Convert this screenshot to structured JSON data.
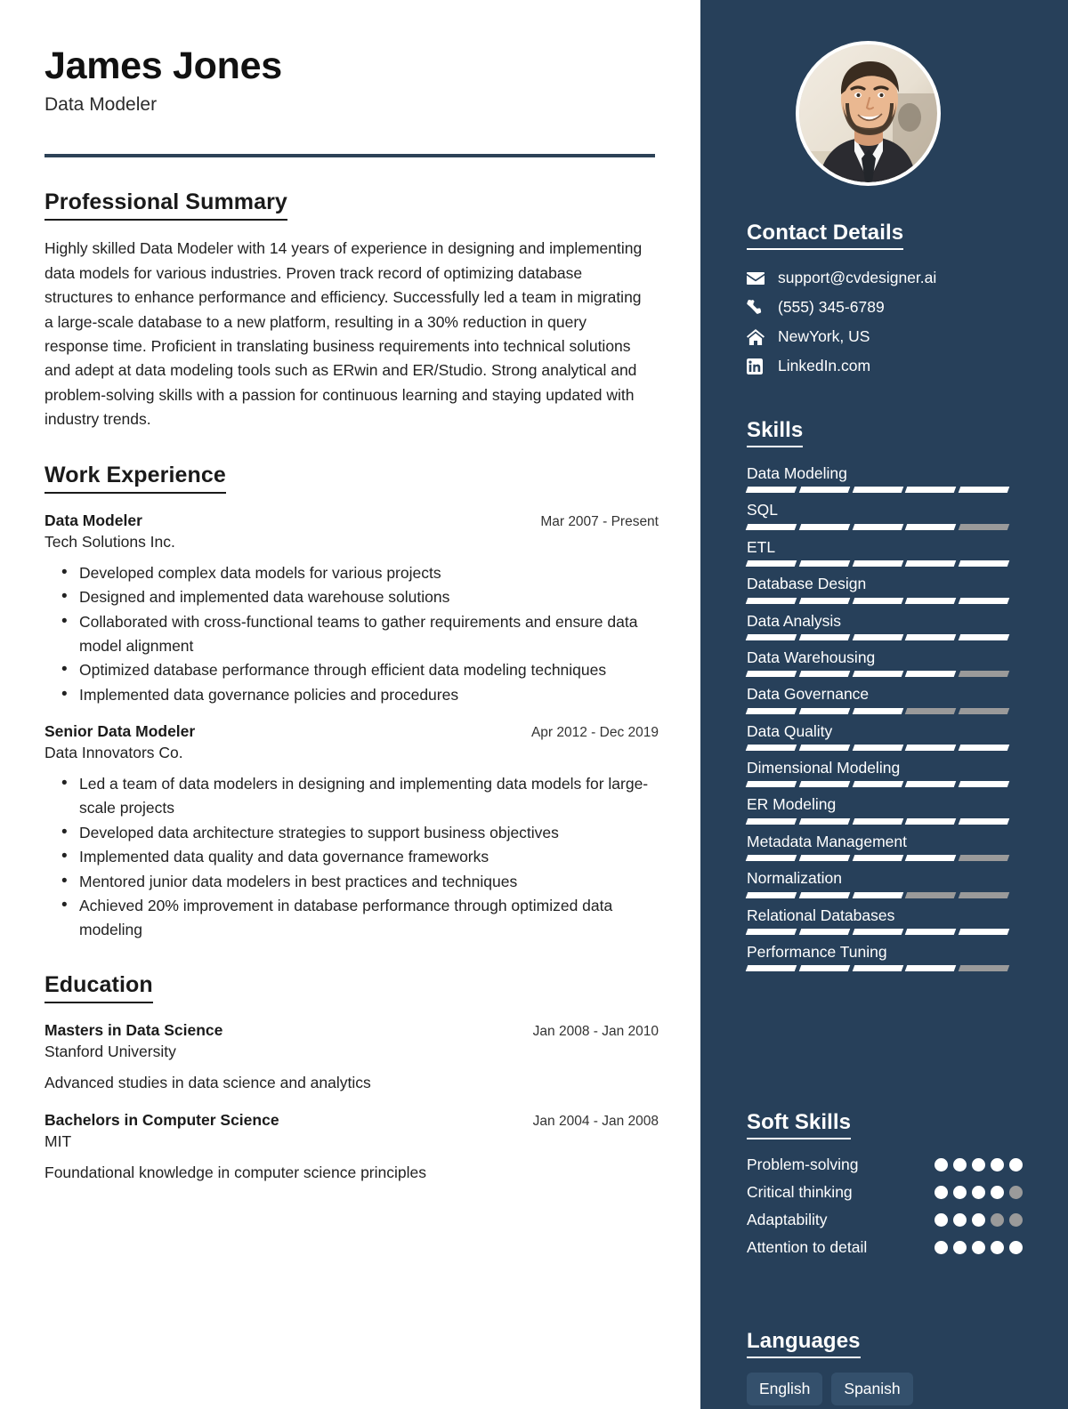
{
  "header": {
    "name": "James Jones",
    "title": "Data Modeler"
  },
  "summary": {
    "heading": "Professional Summary",
    "text": "Highly skilled Data Modeler with 14 years of experience in designing and implementing data models for various industries. Proven track record of optimizing database structures to enhance performance and efficiency. Successfully led a team in migrating a large-scale database to a new platform, resulting in a 30% reduction in query response time. Proficient in translating business requirements into technical solutions and adept at data modeling tools such as ERwin and ER/Studio. Strong analytical and problem-solving skills with a passion for continuous learning and staying updated with industry trends."
  },
  "work": {
    "heading": "Work Experience",
    "entries": [
      {
        "role": "Data Modeler",
        "date": "Mar 2007 - Present",
        "org": "Tech Solutions Inc.",
        "bullets": [
          "Developed complex data models for various projects",
          "Designed and implemented data warehouse solutions",
          "Collaborated with cross-functional teams to gather requirements and ensure data model alignment",
          "Optimized database performance through efficient data modeling techniques",
          "Implemented data governance policies and procedures"
        ]
      },
      {
        "role": "Senior Data Modeler",
        "date": "Apr 2012 - Dec 2019",
        "org": "Data Innovators Co.",
        "bullets": [
          "Led a team of data modelers in designing and implementing data models for large-scale projects",
          "Developed data architecture strategies to support business objectives",
          "Implemented data quality and data governance frameworks",
          "Mentored junior data modelers in best practices and techniques",
          "Achieved 20% improvement in database performance through optimized data modeling"
        ]
      }
    ]
  },
  "education": {
    "heading": "Education",
    "entries": [
      {
        "degree": "Masters in Data Science",
        "date": "Jan 2008 - Jan 2010",
        "school": "Stanford University",
        "desc": "Advanced studies in data science and analytics"
      },
      {
        "degree": "Bachelors in Computer Science",
        "date": "Jan 2004 - Jan 2008",
        "school": "MIT",
        "desc": "Foundational knowledge in computer science principles"
      }
    ]
  },
  "sidebar": {
    "contact": {
      "heading": "Contact Details",
      "items": [
        {
          "icon": "envelope-icon",
          "value": "support@cvdesigner.ai"
        },
        {
          "icon": "phone-icon",
          "value": "(555) 345-6789"
        },
        {
          "icon": "home-icon",
          "value": "NewYork, US"
        },
        {
          "icon": "linkedin-icon",
          "value": "LinkedIn.com"
        }
      ]
    },
    "skills": {
      "heading": "Skills",
      "max": 5,
      "items": [
        {
          "name": "Data Modeling",
          "level": 5
        },
        {
          "name": "SQL",
          "level": 4
        },
        {
          "name": "ETL",
          "level": 5
        },
        {
          "name": "Database Design",
          "level": 5
        },
        {
          "name": "Data Analysis",
          "level": 5
        },
        {
          "name": "Data Warehousing",
          "level": 4
        },
        {
          "name": "Data Governance",
          "level": 3
        },
        {
          "name": "Data Quality",
          "level": 5
        },
        {
          "name": "Dimensional Modeling",
          "level": 5
        },
        {
          "name": "ER Modeling",
          "level": 5
        },
        {
          "name": "Metadata Management",
          "level": 4
        },
        {
          "name": "Normalization",
          "level": 3
        },
        {
          "name": "Relational Databases",
          "level": 5
        },
        {
          "name": "Performance Tuning",
          "level": 4
        }
      ]
    },
    "soft_skills": {
      "heading": "Soft Skills",
      "max": 5,
      "items": [
        {
          "name": "Problem-solving",
          "level": 5
        },
        {
          "name": "Critical thinking",
          "level": 4
        },
        {
          "name": "Adaptability",
          "level": 3
        },
        {
          "name": "Attention to detail",
          "level": 5
        }
      ]
    },
    "languages": {
      "heading": "Languages",
      "items": [
        "English",
        "Spanish"
      ]
    }
  },
  "colors": {
    "sidebar_bg": "#27405a",
    "accent_rule": "#2d4257",
    "chip_bg": "#34506c",
    "bar_on": "#ffffff",
    "bar_off": "#9a9a9a"
  }
}
